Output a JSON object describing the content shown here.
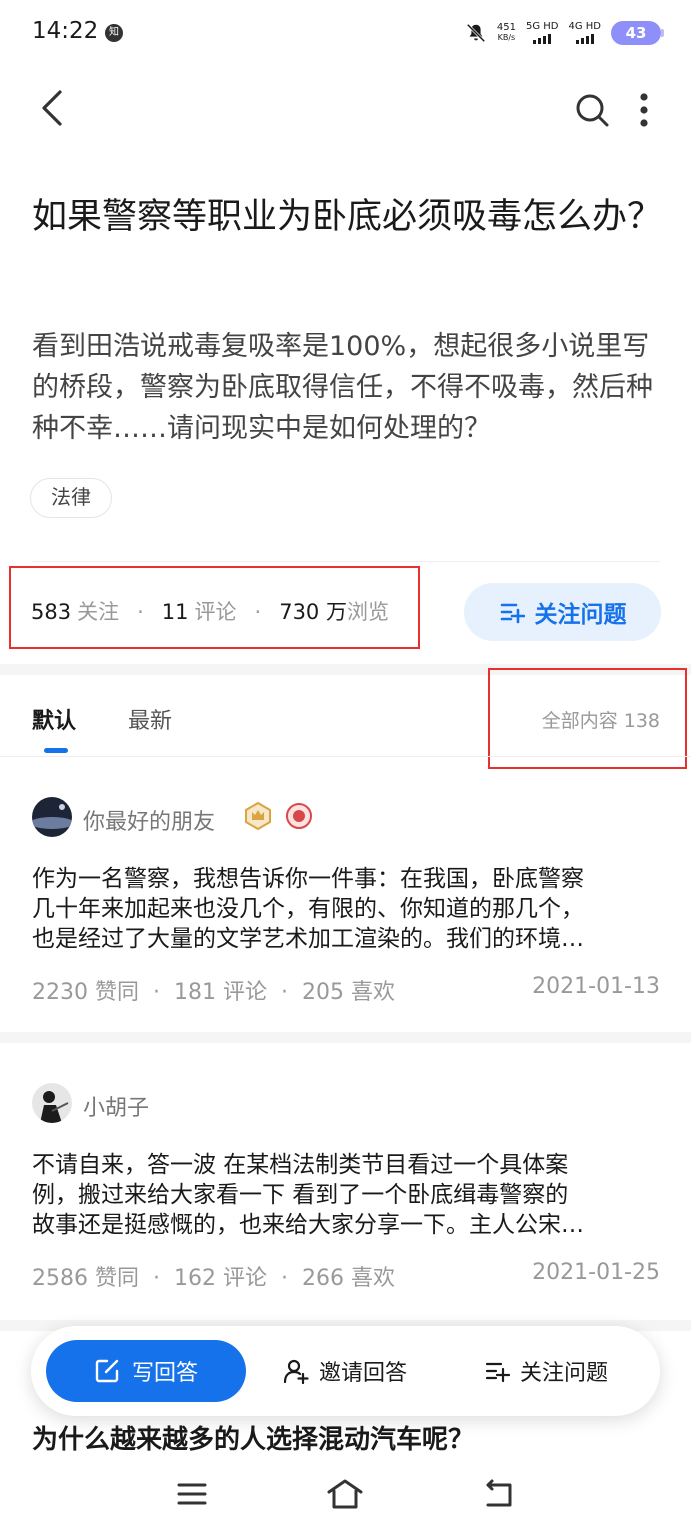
{
  "status_bar": {
    "time": "14:22",
    "app_icon_text": "知",
    "net_speed": "451",
    "net_speed_unit": "KB/s",
    "signal_1": "5G HD",
    "signal_2": "4G HD",
    "battery": "43",
    "battery_color": "#8f8ffa"
  },
  "nav": {
    "back_icon": "back-arrow-icon",
    "search_icon": "search-icon",
    "more_icon": "more-vertical-icon"
  },
  "question": {
    "title": "如果警察等职业为卧底必须吸毒怎么办？",
    "description": "看到田浩说戒毒复吸率是100%，想起很多小说里写的桥段，警察为卧底取得信任，不得不吸毒，然后种种不幸……请问现实中是如何处理的？",
    "tag": "法律"
  },
  "stats": {
    "followers": "583",
    "followers_unit": "关注",
    "comments": "11",
    "comments_unit": "评论",
    "views": "730 万",
    "views_unit": "浏览",
    "separator": "·"
  },
  "follow_button": {
    "label": "关注问题"
  },
  "tabs": {
    "default": "默认",
    "newest": "最新",
    "all_count": "全部内容 138"
  },
  "answers": [
    {
      "author": "你最好的朋友",
      "lines": [
        "作为一名警察，我想告诉你一件事：在我国，卧底警察",
        "几十年来加起来也没几个，有限的、你知道的那几个，",
        "也是经过了大量的文学艺术加工渲染的。我们的环境…"
      ],
      "likes": "2230",
      "likes_unit": "赞同",
      "comments": "181",
      "comments_unit": "评论",
      "favs": "205",
      "favs_unit": "喜欢",
      "date": "2021-01-13"
    },
    {
      "author": "小胡子",
      "lines": [
        "不请自来，答一波 在某档法制类节目看过一个具体案",
        "例，搬过来给大家看一下 看到了一个卧底缉毒警察的",
        "故事还是挺感慨的，也来给大家分享一下。主人公宋…"
      ],
      "likes": "2586",
      "likes_unit": "赞同",
      "comments": "162",
      "comments_unit": "评论",
      "favs": "266",
      "favs_unit": "喜欢",
      "date": "2021-01-25"
    }
  ],
  "next_question": "为什么越来越多的人选择混动汽车呢？",
  "action_bar": {
    "write": "写回答",
    "invite": "邀请回答",
    "follow": "关注问题"
  },
  "colors": {
    "accent": "#1672ea",
    "highlight_box": "#e8312e"
  }
}
